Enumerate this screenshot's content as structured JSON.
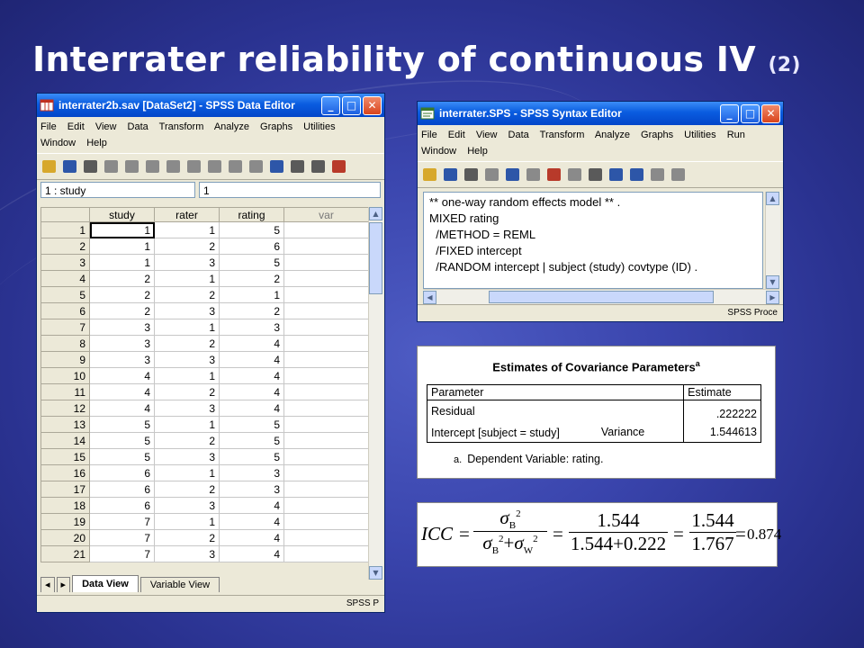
{
  "slide": {
    "title": "Interrater reliability of continuous IV",
    "title_suffix": "(2)"
  },
  "data_editor": {
    "window_title": "interrater2b.sav [DataSet2] - SPSS Data Editor",
    "menus": [
      "File",
      "Edit",
      "View",
      "Data",
      "Transform",
      "Analyze",
      "Graphs",
      "Utilities",
      "Window",
      "Help"
    ],
    "cell_ref": "1 : study",
    "cell_value": "1",
    "columns": [
      "study",
      "rater",
      "rating",
      "var"
    ],
    "rows": [
      [
        "1",
        "1",
        "1",
        "5"
      ],
      [
        "2",
        "1",
        "2",
        "6"
      ],
      [
        "3",
        "1",
        "3",
        "5"
      ],
      [
        "4",
        "2",
        "1",
        "2"
      ],
      [
        "5",
        "2",
        "2",
        "1"
      ],
      [
        "6",
        "2",
        "3",
        "2"
      ],
      [
        "7",
        "3",
        "1",
        "3"
      ],
      [
        "8",
        "3",
        "2",
        "4"
      ],
      [
        "9",
        "3",
        "3",
        "4"
      ],
      [
        "10",
        "4",
        "1",
        "4"
      ],
      [
        "11",
        "4",
        "2",
        "4"
      ],
      [
        "12",
        "4",
        "3",
        "4"
      ],
      [
        "13",
        "5",
        "1",
        "5"
      ],
      [
        "14",
        "5",
        "2",
        "5"
      ],
      [
        "15",
        "5",
        "3",
        "5"
      ],
      [
        "16",
        "6",
        "1",
        "3"
      ],
      [
        "17",
        "6",
        "2",
        "3"
      ],
      [
        "18",
        "6",
        "3",
        "4"
      ],
      [
        "19",
        "7",
        "1",
        "4"
      ],
      [
        "20",
        "7",
        "2",
        "4"
      ],
      [
        "21",
        "7",
        "3",
        "4"
      ]
    ],
    "tabs": [
      "Data View",
      "Variable View"
    ],
    "status": "SPSS P"
  },
  "syntax_editor": {
    "window_title": "interrater.SPS - SPSS Syntax Editor",
    "menus": [
      "File",
      "Edit",
      "View",
      "Data",
      "Transform",
      "Analyze",
      "Graphs",
      "Utilities",
      "Run",
      "Window",
      "Help"
    ],
    "code_lines": [
      "** one-way random effects model ** .",
      "MIXED rating",
      "  /METHOD = REML",
      "  /FIXED intercept",
      "  /RANDOM intercept | subject (study) covtype (ID) ."
    ],
    "status": "SPSS Proce"
  },
  "covariance": {
    "title": "Estimates of Covariance Parameters",
    "title_note": "a",
    "header_parameter": "Parameter",
    "header_estimate": "Estimate",
    "rows": [
      {
        "parameter": "Residual",
        "detail": "",
        "estimate": ".222222"
      },
      {
        "parameter": "Intercept [subject = study]",
        "detail": "Variance",
        "estimate": "1.544613"
      }
    ],
    "footnote_mark": "a.",
    "footnote": "Dependent Variable: rating."
  },
  "icc": {
    "lhs": "ICC",
    "eq": "=",
    "sigma": "σ",
    "sub_b": "B",
    "sub_w": "W",
    "exp": "2",
    "plus": "+",
    "n1_num": "1.544",
    "n1_den": "1.544+0.222",
    "n2_num": "1.544",
    "n2_den": "1.767",
    "result": "0.874"
  },
  "colors": {
    "titlebar": "#0a5ce0",
    "window_bg": "#ece9d8",
    "slide_bg": "#3a45ad"
  }
}
